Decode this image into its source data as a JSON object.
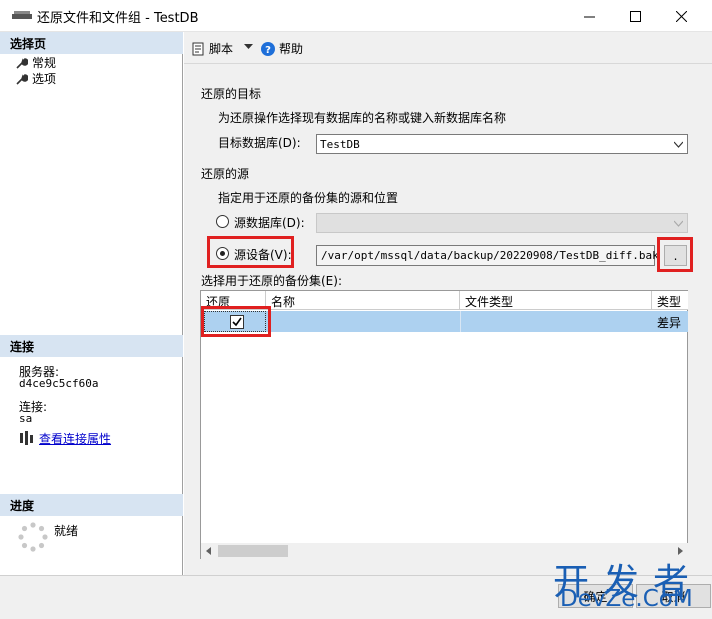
{
  "window": {
    "title": "还原文件和文件组 - TestDB"
  },
  "left": {
    "select_page": "选择页",
    "nav": [
      {
        "label": "常规"
      },
      {
        "label": "选项"
      }
    ],
    "connection": {
      "header": "连接",
      "server_label": "服务器:",
      "server_value": "d4ce9c5cf60a",
      "conn_label": "连接:",
      "conn_value": "sa",
      "view_link": "查看连接属性"
    },
    "progress": {
      "header": "进度",
      "status": "就绪"
    }
  },
  "toolbar": {
    "script_label": "脚本",
    "help_label": "帮助"
  },
  "dest": {
    "section": "还原的目标",
    "desc": "为还原操作选择现有数据库的名称或键入新数据库名称",
    "db_label": "目标数据库(D):",
    "db_value": "TestDB"
  },
  "source": {
    "section": "还原的源",
    "desc": "指定用于还原的备份集的源和位置",
    "from_db_label": "源数据库(D):",
    "from_device_label": "源设备(V):",
    "device_path": "/var/opt/mssql/data/backup/20220908/TestDB_diff.bak",
    "browse_label": "."
  },
  "backupsets": {
    "label": "选择用于还原的备份集(E):",
    "columns": [
      "还原",
      "名称",
      "文件类型",
      "类型"
    ],
    "rows": [
      {
        "restore_checked": true,
        "name": "",
        "file_type": "",
        "type": "差异"
      }
    ]
  },
  "buttons": {
    "ok": "确定",
    "cancel": "取消"
  },
  "watermark": {
    "cn": "开发者",
    "en": "DevZe.CoM"
  },
  "colors": {
    "highlight": "#e02020",
    "selected_row": "#add1f0",
    "link": "#0000cc",
    "section_header": "#d7e4f2"
  }
}
